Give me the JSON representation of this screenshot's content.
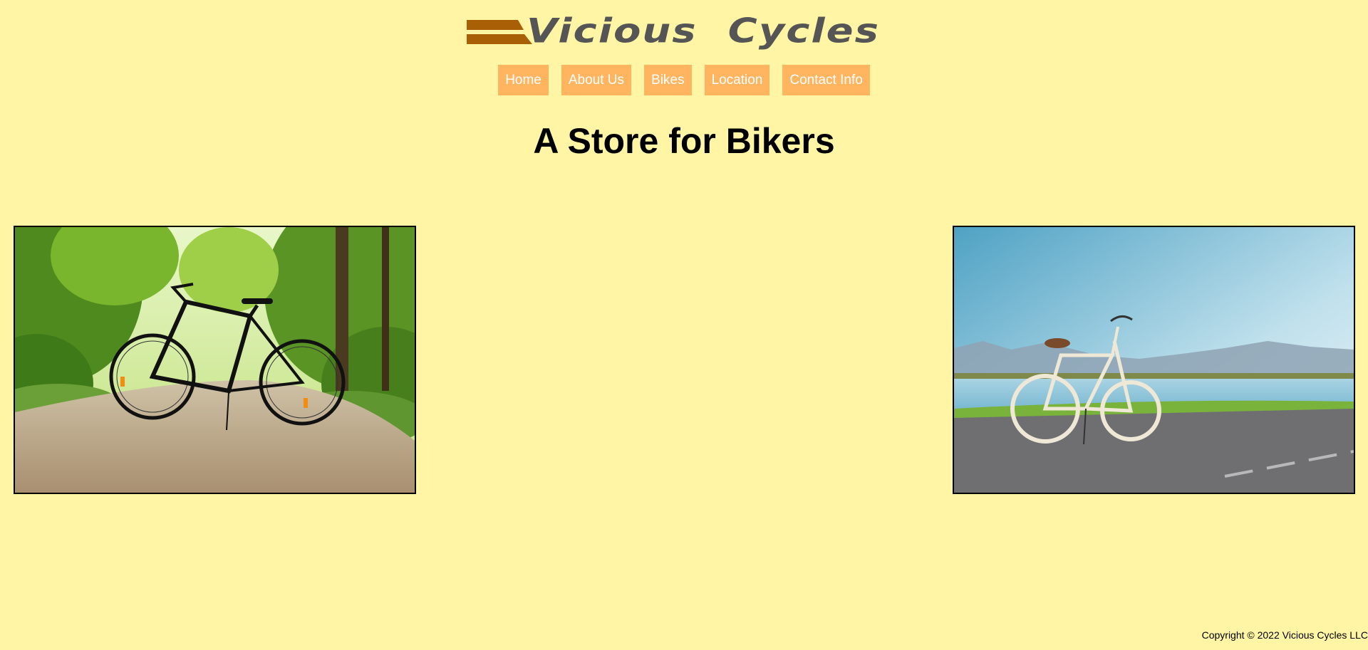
{
  "brand": {
    "name": "Vicious  Cycles",
    "logo_color": "#a85f06",
    "text_color": "#555555"
  },
  "nav": {
    "items": [
      {
        "label": "Home"
      },
      {
        "label": "About Us"
      },
      {
        "label": "Bikes"
      },
      {
        "label": "Location"
      },
      {
        "label": "Contact Info"
      }
    ],
    "button_color": "#ffb560"
  },
  "main": {
    "heading": "A Store for Bikers"
  },
  "images": {
    "left": {
      "depicts": "black-bicycle-on-forest-path"
    },
    "right": {
      "depicts": "white-bicycle-by-lake"
    }
  },
  "footer": {
    "copyright": "Copyright © 2022 Vicious Cycles LLC"
  },
  "colors": {
    "background": "#fff5a5"
  }
}
